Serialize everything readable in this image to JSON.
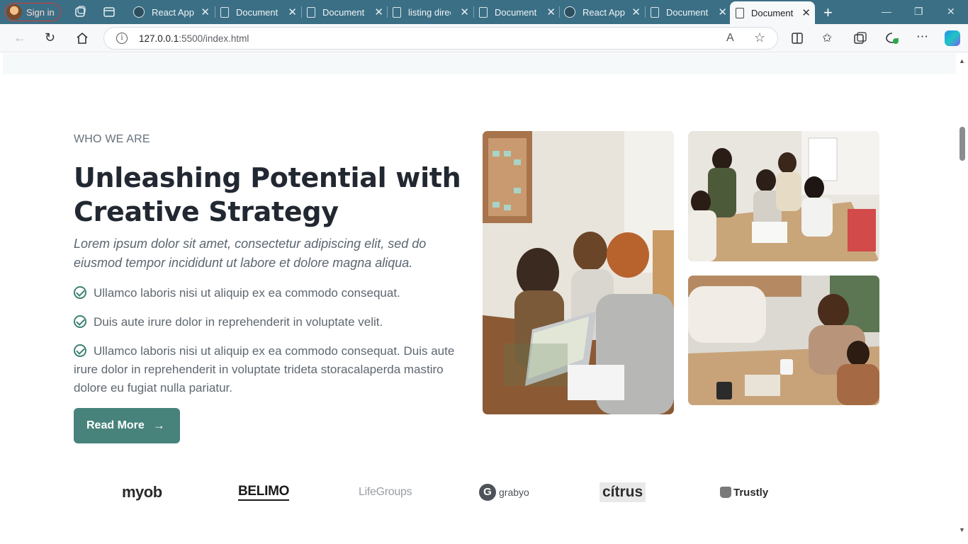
{
  "browser": {
    "signin_label": "Sign in",
    "tabs": [
      {
        "label": "React App",
        "icon": "react-icon"
      },
      {
        "label": "Document",
        "icon": "document-icon"
      },
      {
        "label": "Document",
        "icon": "document-icon"
      },
      {
        "label": "listing direc",
        "icon": "document-icon"
      },
      {
        "label": "Document",
        "icon": "document-icon"
      },
      {
        "label": "React App",
        "icon": "react-icon"
      },
      {
        "label": "Document",
        "icon": "document-icon"
      },
      {
        "label": "Document",
        "icon": "document-icon",
        "active": true
      }
    ],
    "url_host": "127.0.0.1",
    "url_path": ":5500/index.html"
  },
  "section": {
    "eyebrow": "WHO WE ARE",
    "title": "Unleashing Potential with Creative Strategy",
    "lead": "Lorem ipsum dolor sit amet, consectetur adipiscing elit, sed do eiusmod tempor incididunt ut labore et dolore magna aliqua.",
    "checks": [
      "Ullamco laboris nisi ut aliquip ex ea commodo consequat.",
      "Duis aute irure dolor in reprehenderit in voluptate velit.",
      "Ullamco laboris nisi ut aliquip ex ea commodo consequat. Duis aute irure dolor in reprehenderit in voluptate trideta storacalaperda mastiro dolore eu fugiat nulla pariatur."
    ],
    "button_label": "Read More"
  },
  "logos": {
    "myob": "myob",
    "belimo_a": "BELIM",
    "belimo_b": "O",
    "lifegroups": "LifeGroups",
    "grabyo_mark": "G",
    "grabyo": "grabyo",
    "citrus": "cítrus",
    "trustly": "Trustly"
  },
  "colors": {
    "accent": "#47827b",
    "tabbar": "#3b6f85",
    "heading": "#222831"
  }
}
